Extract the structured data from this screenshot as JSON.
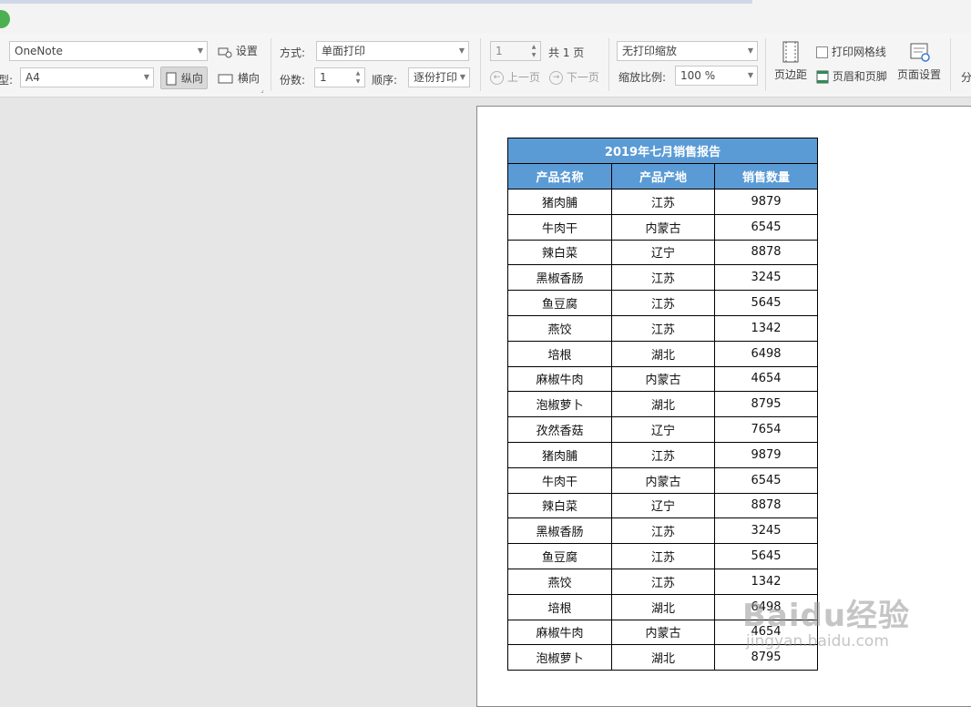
{
  "toolbar": {
    "printer": "OneNote",
    "settings_label": "设置",
    "paper_type_label": "型:",
    "paper_size": "A4",
    "portrait_label": "纵向",
    "landscape_label": "横向",
    "mode_label": "方式:",
    "mode_value": "单面打印",
    "copies_label": "份数:",
    "copies_value": "1",
    "order_label": "顺序:",
    "order_value": "逐份打印",
    "page_input": "1",
    "total_pages": "共 1 页",
    "prev_page": "上一页",
    "next_page": "下一页",
    "scaling_mode": "无打印缩放",
    "zoom_label": "缩放比例:",
    "zoom_value": "100 %",
    "margins_label": "页边距",
    "print_gridlines_label": "打印网格线",
    "header_footer_label": "页眉和页脚",
    "page_setup_label": "页面设置",
    "split_label": "分"
  },
  "report": {
    "title": "2019年七月销售报告",
    "headers": [
      "产品名称",
      "产品产地",
      "销售数量"
    ],
    "rows": [
      [
        "猪肉脯",
        "江苏",
        "9879"
      ],
      [
        "牛肉干",
        "内蒙古",
        "6545"
      ],
      [
        "辣白菜",
        "辽宁",
        "8878"
      ],
      [
        "黑椒香肠",
        "江苏",
        "3245"
      ],
      [
        "鱼豆腐",
        "江苏",
        "5645"
      ],
      [
        "燕饺",
        "江苏",
        "1342"
      ],
      [
        "培根",
        "湖北",
        "6498"
      ],
      [
        "麻椒牛肉",
        "内蒙古",
        "4654"
      ],
      [
        "泡椒萝卜",
        "湖北",
        "8795"
      ],
      [
        "孜然香菇",
        "辽宁",
        "7654"
      ],
      [
        "猪肉脯",
        "江苏",
        "9879"
      ],
      [
        "牛肉干",
        "内蒙古",
        "6545"
      ],
      [
        "辣白菜",
        "辽宁",
        "8878"
      ],
      [
        "黑椒香肠",
        "江苏",
        "3245"
      ],
      [
        "鱼豆腐",
        "江苏",
        "5645"
      ],
      [
        "燕饺",
        "江苏",
        "1342"
      ],
      [
        "培根",
        "湖北",
        "6498"
      ],
      [
        "麻椒牛肉",
        "内蒙古",
        "4654"
      ],
      [
        "泡椒萝卜",
        "湖北",
        "8795"
      ]
    ]
  },
  "watermark": {
    "brand": "Baidu经验",
    "url": "jingyan.baidu.com"
  },
  "colors": {
    "header_fill": "#5b9bd5",
    "status_dot": "#4caf50"
  }
}
